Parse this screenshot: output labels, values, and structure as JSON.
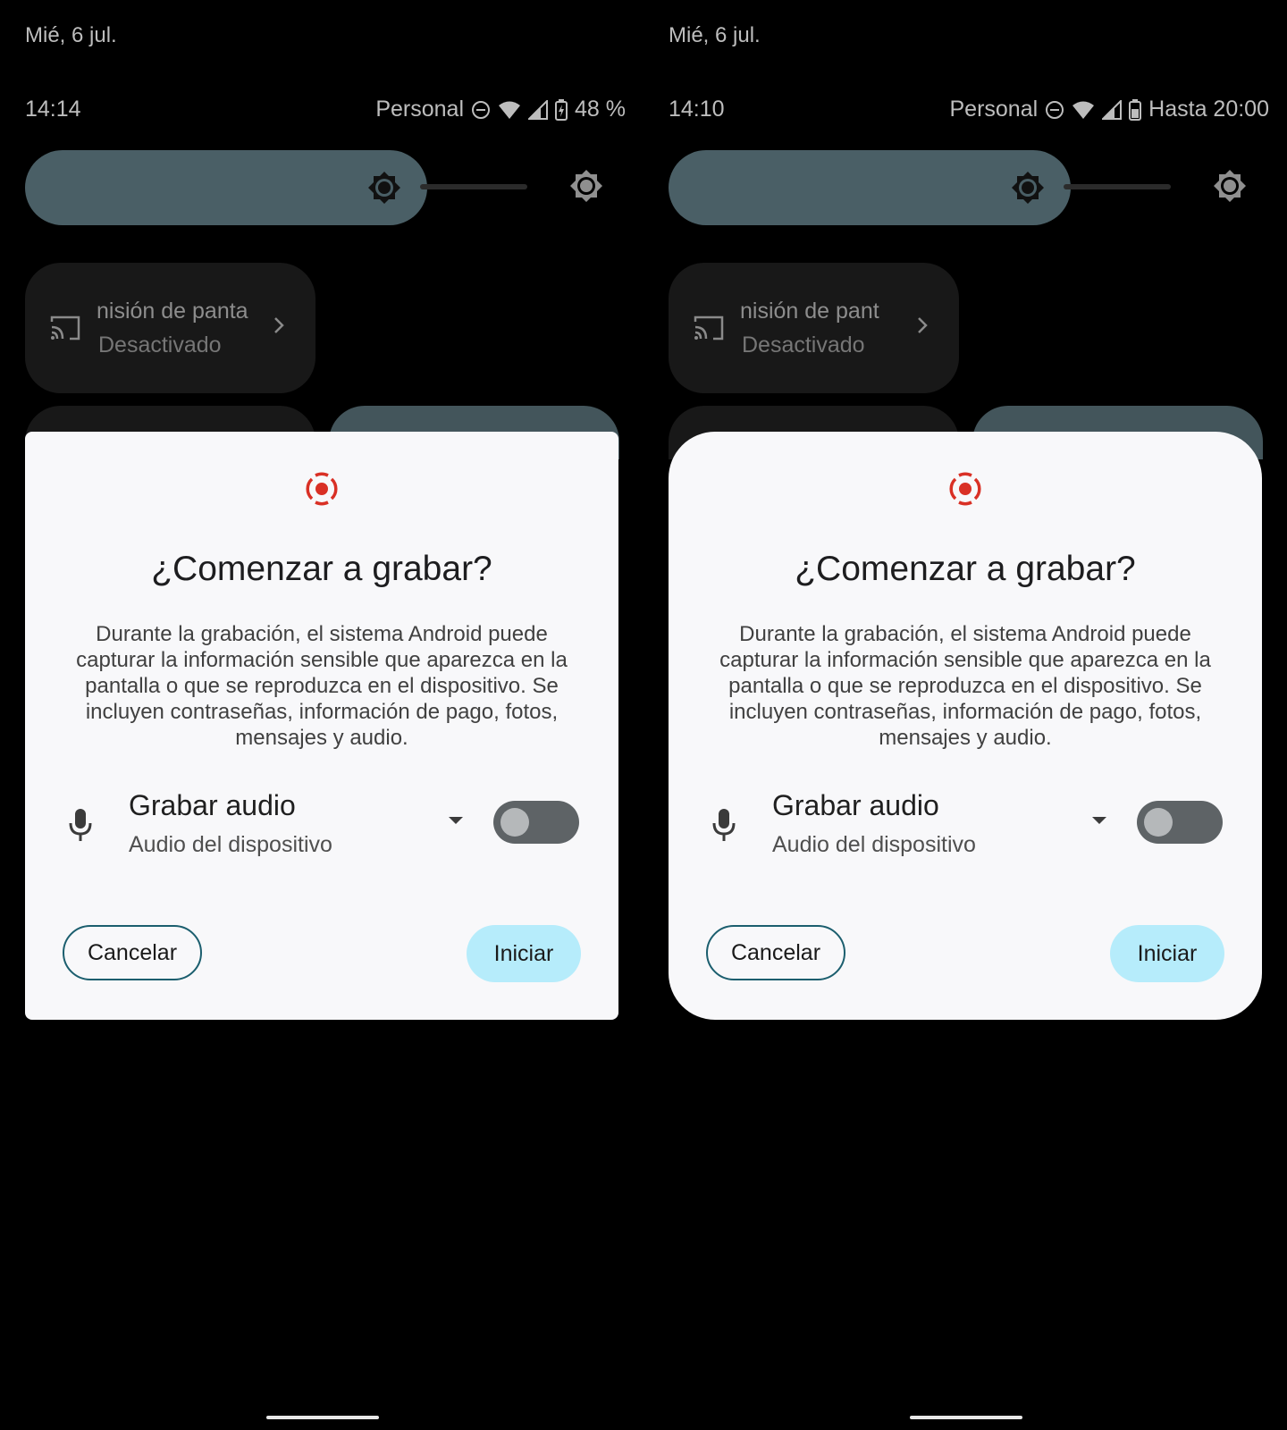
{
  "colors": {
    "accent_record": "#d93025",
    "slider": "#4a5f66",
    "start_button": "#b6ecfb",
    "cancel_border": "#1b5e6e"
  },
  "screens": [
    {
      "date": "Mié, 6 jul.",
      "time": "14:14",
      "profile": "Personal",
      "battery_text": "48 %",
      "battery_icon": "battery-charging-icon",
      "tile": {
        "name": "nisión de panta",
        "state": "Desactivado"
      },
      "dialog": {
        "title": "¿Comenzar a grabar?",
        "body": "Durante la grabación, el sistema Android puede capturar la información sensible que aparezca en la pantalla o que se reproduzca en el dispositivo. Se incluyen contraseñas, información de pago, fotos, mensajes y audio.",
        "audio_title": "Grabar audio",
        "audio_source": "Audio del dispositivo",
        "toggle_on": false,
        "cancel_label": "Cancelar",
        "start_label": "Iniciar"
      }
    },
    {
      "date": "Mié, 6 jul.",
      "time": "14:10",
      "profile": "Personal",
      "battery_text": "Hasta 20:00",
      "battery_icon": "battery-icon",
      "tile": {
        "name": "nisión de pant",
        "state": "Desactivado"
      },
      "dialog": {
        "title": "¿Comenzar a grabar?",
        "body": "Durante la grabación, el sistema Android puede capturar la información sensible que aparezca en la pantalla o que se reproduzca en el dispositivo. Se incluyen contraseñas, información de pago, fotos, mensajes y audio.",
        "audio_title": "Grabar audio",
        "audio_source": "Audio del dispositivo",
        "toggle_on": false,
        "cancel_label": "Cancelar",
        "start_label": "Iniciar"
      }
    }
  ]
}
